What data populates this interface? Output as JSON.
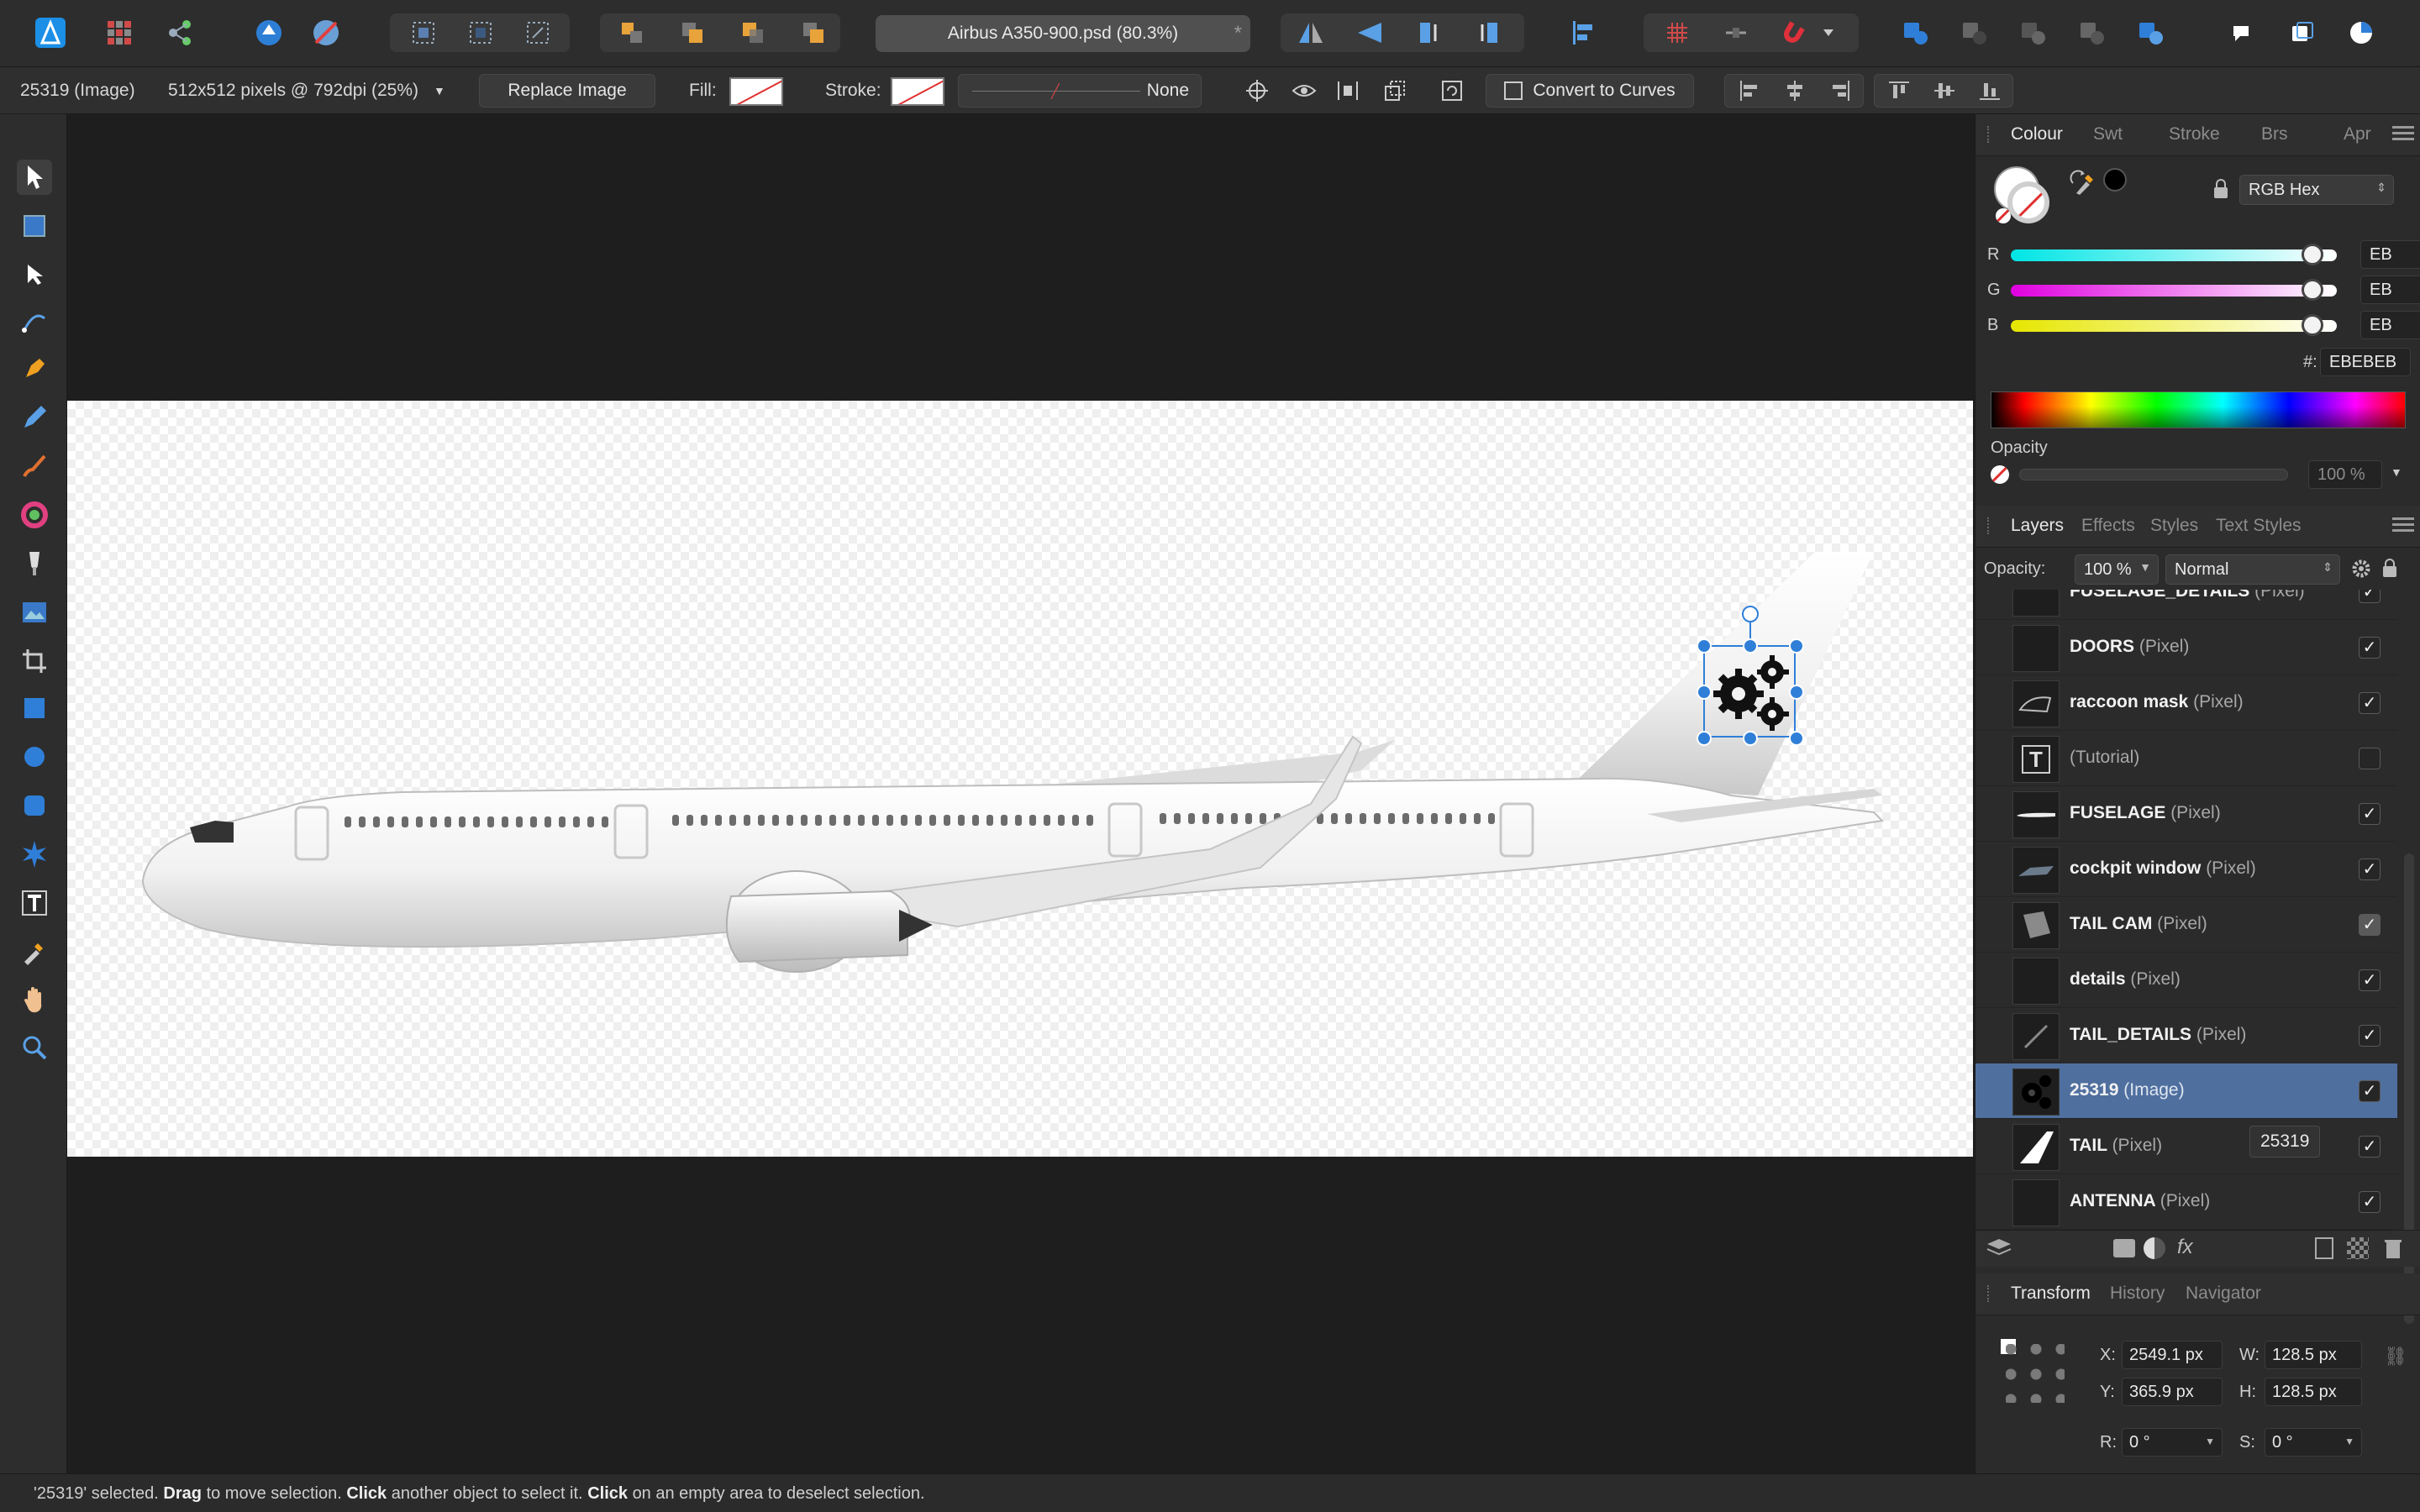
{
  "document": {
    "tab_title": "Airbus A350-900.psd (80.3%)",
    "tab_close": "*"
  },
  "context_bar": {
    "layer_info": "25319 (Image)",
    "image_info": "512x512 pixels @ 792dpi (25%)",
    "replace_image": "Replace Image",
    "fill_label": "Fill:",
    "stroke_label": "Stroke:",
    "stroke_width": "None",
    "convert_to_curves": "Convert to Curves"
  },
  "colour_panel": {
    "tabs": [
      "Colour",
      "Swt",
      "Stroke",
      "Brs",
      "Apr"
    ],
    "mode": "RGB Hex",
    "channels": [
      {
        "label": "R",
        "value": "EB"
      },
      {
        "label": "G",
        "value": "EB"
      },
      {
        "label": "B",
        "value": "EB"
      }
    ],
    "hex_label": "#:",
    "hex_value": "EBEBEB",
    "opacity_label": "Opacity",
    "opacity_value": "100 %"
  },
  "layers_panel": {
    "tabs": [
      "Layers",
      "Effects",
      "Styles",
      "Text Styles"
    ],
    "opacity_label": "Opacity:",
    "opacity_value": "100 %",
    "blend_mode": "Normal",
    "tooltip": "25319",
    "layers": [
      {
        "name": "FUSELAGE_DETAILS",
        "kind": "(Pixel)",
        "checked": "✓"
      },
      {
        "name": "DOORS",
        "kind": "(Pixel)",
        "checked": "✓"
      },
      {
        "name": "raccoon mask",
        "kind": "(Pixel)",
        "checked": "✓"
      },
      {
        "name": "(Tutorial)",
        "kind": "",
        "checked": ""
      },
      {
        "name": "FUSELAGE",
        "kind": "(Pixel)",
        "checked": "✓"
      },
      {
        "name": "cockpit window",
        "kind": "(Pixel)",
        "checked": "✓"
      },
      {
        "name": "TAIL CAM",
        "kind": "(Pixel)",
        "checked": "✓"
      },
      {
        "name": "details",
        "kind": "(Pixel)",
        "checked": "✓"
      },
      {
        "name": "TAIL_DETAILS",
        "kind": "(Pixel)",
        "checked": "✓"
      },
      {
        "name": "25319",
        "kind": "(Image)",
        "checked": "✓"
      },
      {
        "name": "TAIL",
        "kind": "(Pixel)",
        "checked": "✓"
      },
      {
        "name": "ANTENNA",
        "kind": "(Pixel)",
        "checked": "✓"
      }
    ]
  },
  "transform_panel": {
    "tabs": [
      "Transform",
      "History",
      "Navigator"
    ],
    "x_label": "X:",
    "x_value": "2549.1 px",
    "y_label": "Y:",
    "y_value": "365.9 px",
    "w_label": "W:",
    "w_value": "128.5 px",
    "h_label": "H:",
    "h_value": "128.5 px",
    "r_label": "R:",
    "r_value": "0 °",
    "s_label": "S:",
    "s_value": "0 °"
  },
  "status_bar": {
    "selected": "'25319' selected.",
    "drag": "Drag",
    "drag_text": "to move selection.",
    "click": "Click",
    "click_text": "another object to select it.",
    "click2": "Click",
    "click2_text": "on an empty area to deselect selection."
  },
  "colors": {
    "accent": "#4f6f9f",
    "selection_handle": "#2f7fd8",
    "app_icon": "#1c8fe6"
  }
}
